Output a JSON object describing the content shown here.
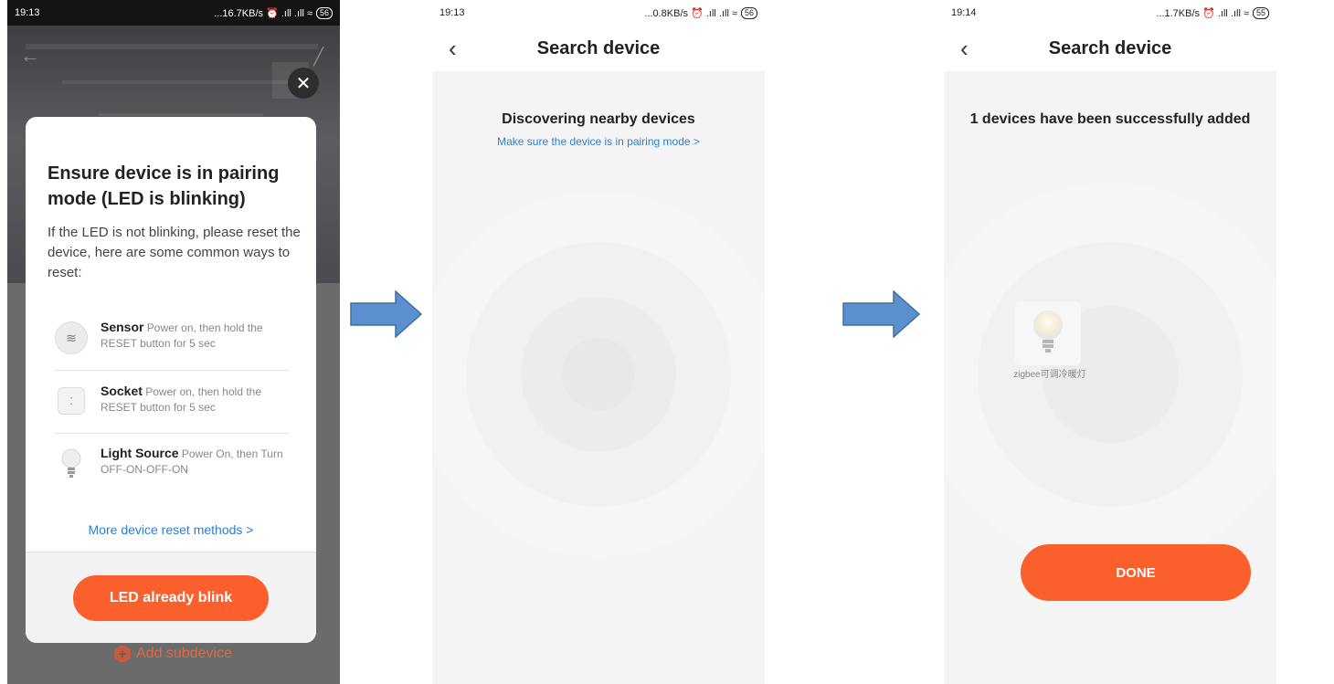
{
  "colors": {
    "accent": "#fb5f2b",
    "link": "#2b7fcf"
  },
  "panel1": {
    "status": {
      "time": "19:13",
      "right": "...16.7KB/s ⏰ .ıll .ıll ≈",
      "battery": "56"
    },
    "close_icon": "close-icon",
    "modal": {
      "title": "Ensure device is in pairing mode (LED is blinking)",
      "description": "If the LED is not blinking, please reset the device, here are some common ways to reset:",
      "items": [
        {
          "icon": "sensor-icon",
          "name": "Sensor",
          "text": " Power on, then hold the RESET button for 5 sec"
        },
        {
          "icon": "socket-icon",
          "name": "Socket",
          "text": " Power on, then hold the RESET button for 5 sec"
        },
        {
          "icon": "bulb-icon",
          "name": "Light Source",
          "text": " Power On, then Turn OFF-ON-OFF-ON"
        }
      ],
      "more_link": "More device reset methods >",
      "button": "LED already blink"
    },
    "add_subdevice": "Add subdevice"
  },
  "panel2": {
    "status": {
      "time": "19:13",
      "right": "...0.8KB/s ⏰ .ıll .ıll ≈",
      "battery": "56"
    },
    "title": "Search device",
    "heading": "Discovering nearby devices",
    "link": "Make sure the device is in pairing mode >"
  },
  "panel3": {
    "status": {
      "time": "19:14",
      "right": "...1.7KB/s ⏰ .ıll .ıll ≈",
      "battery": "55"
    },
    "title": "Search device",
    "heading": "1 devices have been successfully added",
    "device_name": "zigbee可调冷暖灯",
    "button": "DONE"
  }
}
